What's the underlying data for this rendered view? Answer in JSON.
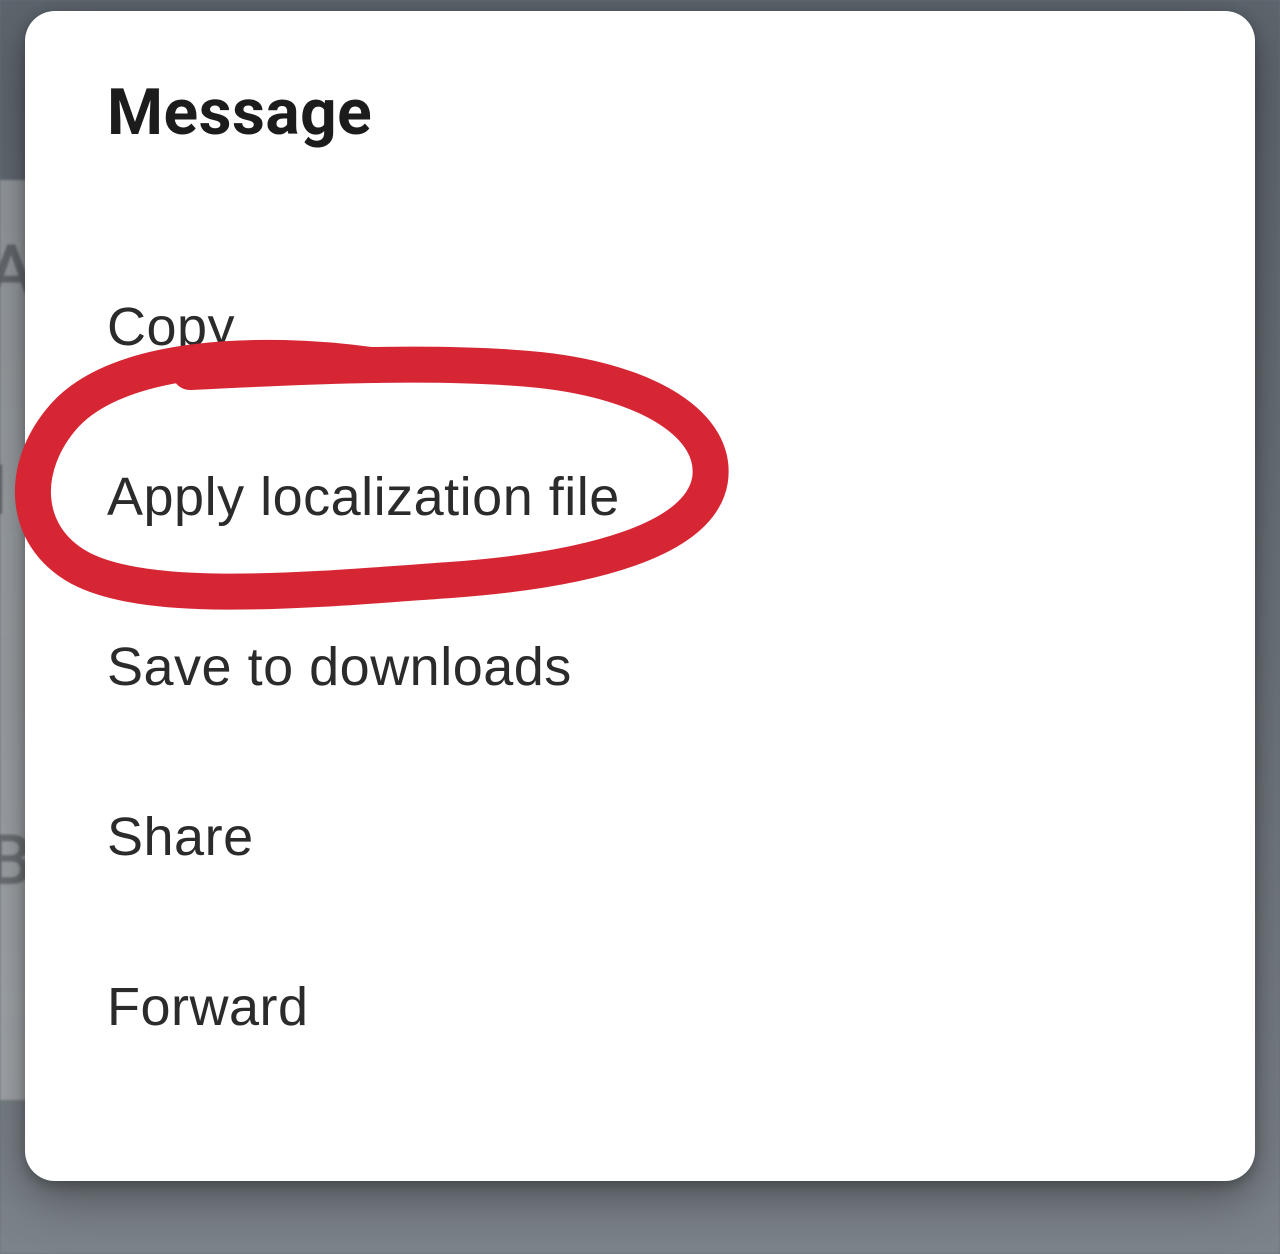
{
  "dialog": {
    "title": "Message",
    "menu_items": [
      {
        "label": "Copy"
      },
      {
        "label": "Apply localization file"
      },
      {
        "label": "Save to downloads"
      },
      {
        "label": "Share"
      },
      {
        "label": "Forward"
      }
    ]
  },
  "annotation": {
    "highlight_index": 1,
    "stroke_color": "#d62634"
  }
}
